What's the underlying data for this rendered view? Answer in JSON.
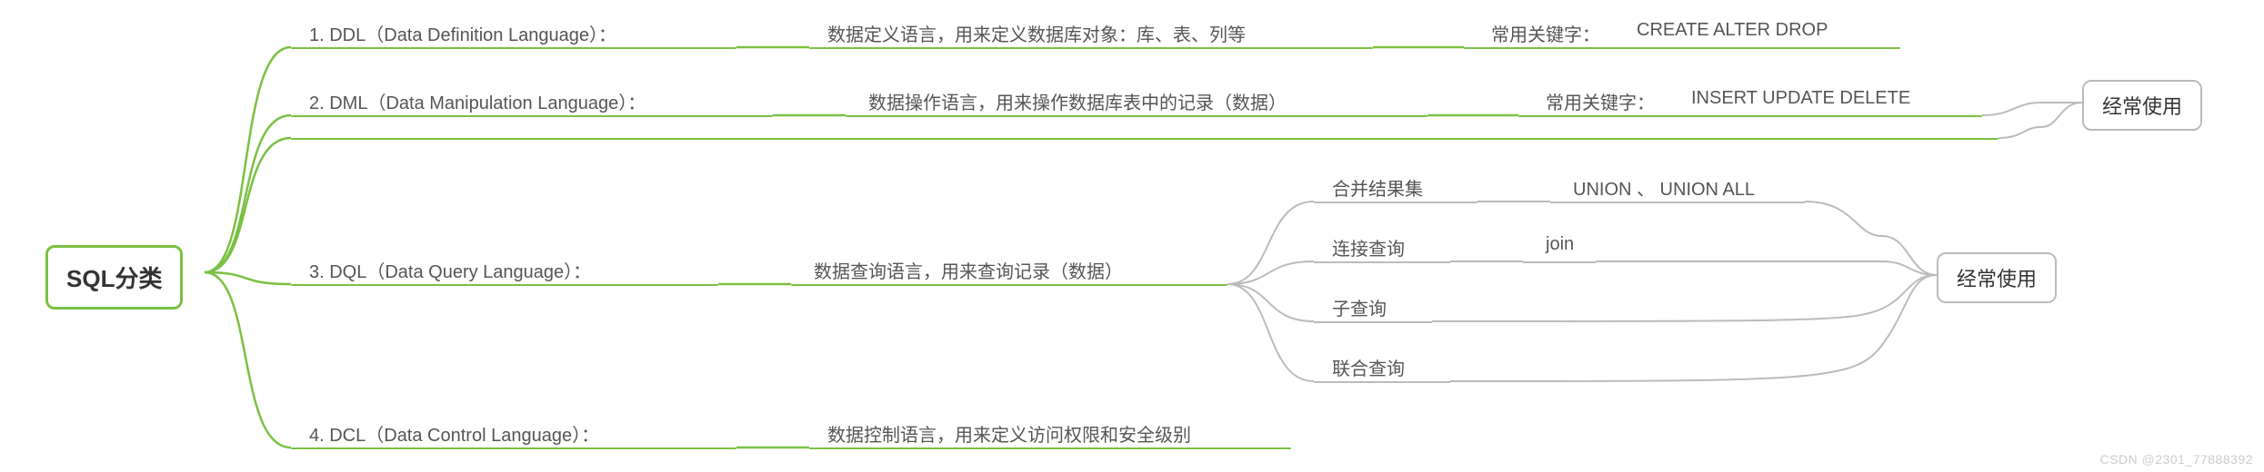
{
  "root": {
    "title": "SQL分类"
  },
  "branches": {
    "ddl": {
      "label": "1. DDL（Data Definition Language）：",
      "desc": "数据定义语言，用来定义数据库对象：库、表、列等",
      "keywords_label": "常用关键字：",
      "keywords": "CREATE  ALTER  DROP"
    },
    "dml": {
      "label": "2. DML（Data Manipulation Language）：",
      "desc": "数据操作语言，用来操作数据库表中的记录（数据）",
      "keywords_label": "常用关键字：",
      "keywords": "INSERT UPDATE  DELETE",
      "badge": "经常使用"
    },
    "dql": {
      "label": "3. DQL（Data Query Language）：",
      "desc": "数据查询语言，用来查询记录（数据）",
      "children": {
        "union": {
          "label": "合并结果集",
          "detail": "UNION 、 UNION ALL"
        },
        "join": {
          "label": "连接查询",
          "detail": "join"
        },
        "sub": {
          "label": "子查询"
        },
        "combine": {
          "label": "联合查询"
        }
      },
      "badge": "经常使用"
    },
    "dcl": {
      "label": "4. DCL（Data Control Language）：",
      "desc": "数据控制语言，用来定义访问权限和安全级别"
    }
  },
  "watermark": "CSDN @2301_77888392"
}
